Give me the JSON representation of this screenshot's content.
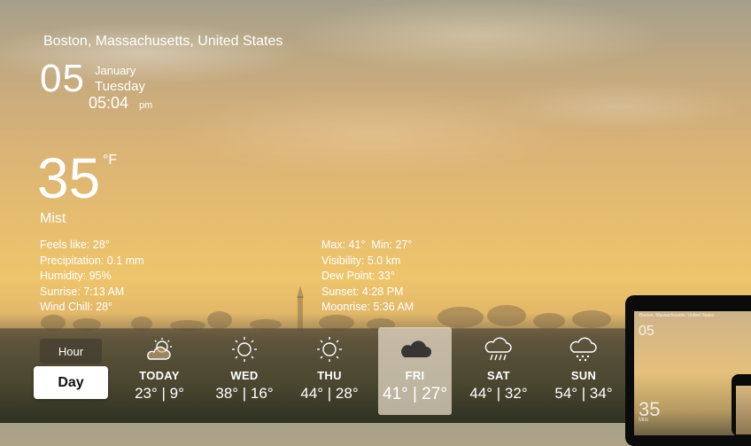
{
  "location": "Boston, Massachusetts, United States",
  "date": {
    "day": "05",
    "month": "January",
    "weekday": "Tuesday",
    "time": "05:04",
    "ampm": "pm"
  },
  "current": {
    "temp": "35",
    "unit": "°F",
    "condition": "Mist"
  },
  "details_left": [
    "Feels like: 28°",
    "Precipitation: 0.1 mm",
    "Humidity: 95%",
    "Sunrise: 7:13 AM",
    "Wind Chill: 28°"
  ],
  "details_right": [
    "Max: 41°  Min: 27°",
    "Visibility: 5.0 km",
    "Dew Point: 33°",
    "Sunset: 4:28 PM",
    "Moonrise: 5:36 AM"
  ],
  "toggle": {
    "hour": "Hour",
    "day": "Day"
  },
  "forecast": [
    {
      "label": "TODAY",
      "range": "23° | 9°",
      "icon": "partly-cloudy-icon"
    },
    {
      "label": "WED",
      "range": "38° | 16°",
      "icon": "sun-icon"
    },
    {
      "label": "THU",
      "range": "44° | 28°",
      "icon": "sun-icon"
    },
    {
      "label": "FRI",
      "range": "41° | 27°",
      "icon": "cloud-icon"
    },
    {
      "label": "SAT",
      "range": "44° | 32°",
      "icon": "rain-cloud-icon"
    },
    {
      "label": "SUN",
      "range": "54° | 34°",
      "icon": "snow-cloud-icon"
    }
  ],
  "device_preview": {
    "location": "Boston, Massachusetts, United States",
    "date": "05",
    "temp": "35",
    "condition": "Mist"
  },
  "colors": {
    "selected_tile": "#ebe1cd",
    "text": "#ffffff"
  }
}
